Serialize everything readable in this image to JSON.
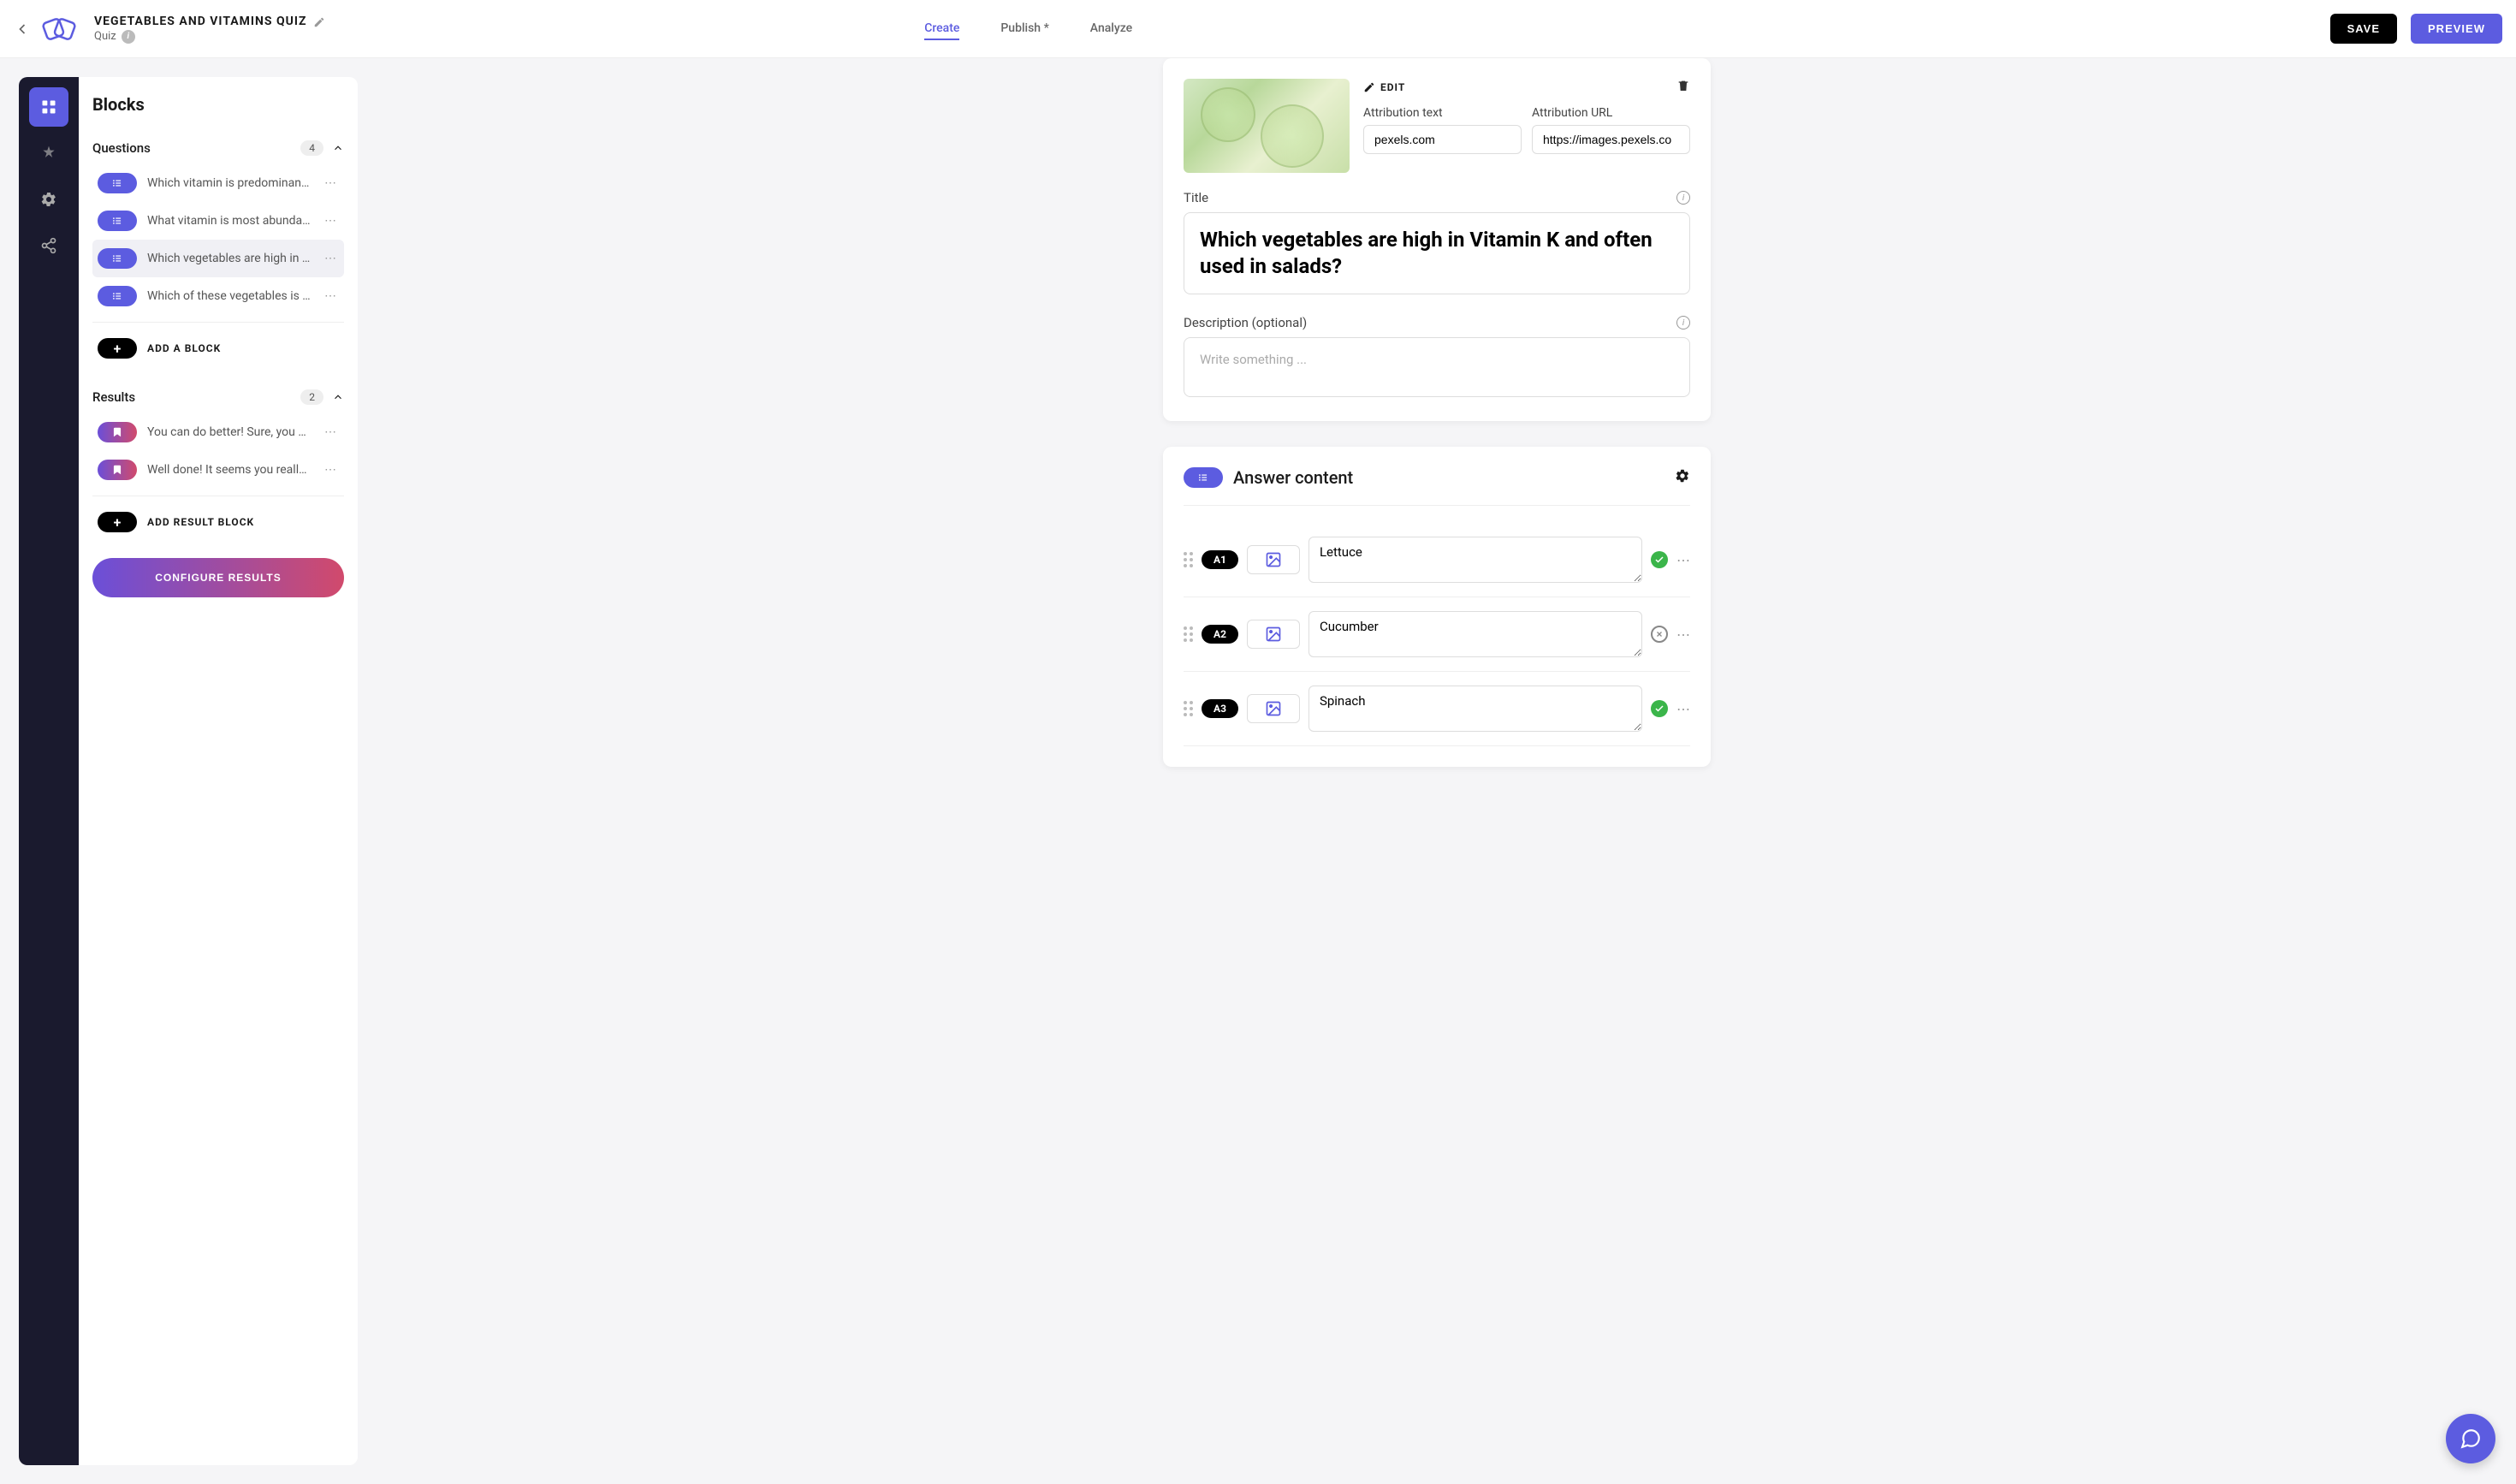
{
  "header": {
    "title": "VEGETABLES AND VITAMINS QUIZ",
    "subtitle": "Quiz",
    "tabs": {
      "create": "Create",
      "publish": "Publish *",
      "analyze": "Analyze"
    },
    "save": "SAVE",
    "preview": "PREVIEW"
  },
  "sidebar": {
    "heading": "Blocks",
    "questions_label": "Questions",
    "questions_count": "4",
    "results_label": "Results",
    "results_count": "2",
    "questions": [
      {
        "text": "Which vitamin is predominantl…"
      },
      {
        "text": "What vitamin is most abundan…"
      },
      {
        "text": "Which vegetables are high in …"
      },
      {
        "text": "Which of these vegetables is …"
      }
    ],
    "results": [
      {
        "text": "You can do better! Sure, you …"
      },
      {
        "text": "Well done! It seems you really…"
      }
    ],
    "add_block": "ADD A BLOCK",
    "add_result": "ADD RESULT BLOCK",
    "configure": "CONFIGURE RESULTS"
  },
  "editor": {
    "edit_label": "EDIT",
    "attr_text_label": "Attribution text",
    "attr_text_value": "pexels.com",
    "attr_url_label": "Attribution URL",
    "attr_url_value": "https://images.pexels.co",
    "title_label": "Title",
    "title_value": "Which vegetables are high in Vitamin K and often used in salads?",
    "desc_label": "Description (optional)",
    "desc_placeholder": "Write something ..."
  },
  "answers": {
    "heading": "Answer content",
    "items": [
      {
        "tag": "A1",
        "text": "Lettuce",
        "correct": true
      },
      {
        "tag": "A2",
        "text": "Cucumber",
        "correct": false
      },
      {
        "tag": "A3",
        "text": "Spinach",
        "correct": true
      }
    ]
  }
}
